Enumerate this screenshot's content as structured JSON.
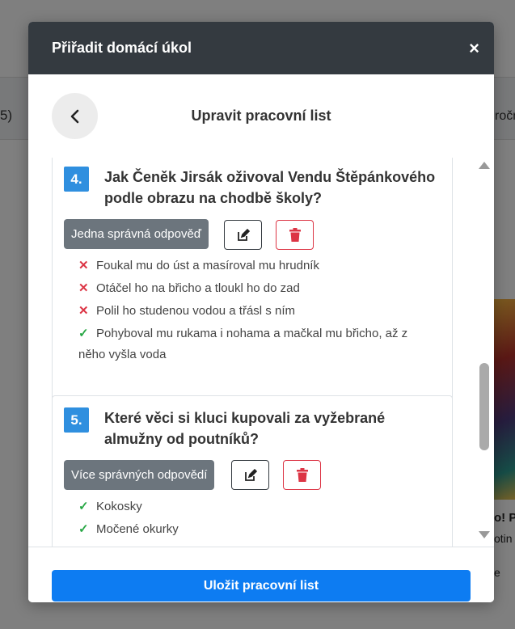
{
  "background": {
    "left_text": "5)",
    "right_text": "ročn",
    "caption1": "o! P",
    "caption2": "otin",
    "caption3": "e"
  },
  "modal": {
    "title": "Přiřadit domácí úkol",
    "close_symbol": "×",
    "sub_title": "Upravit pracovní list",
    "back_icon": "chevron-left",
    "save_label": "Uložit pracovní list"
  },
  "questions": [
    {
      "number": "4.",
      "text": "Jak Čeněk Jirsák oživoval Vendu Štěpánkového podle obrazu na chodbě školy?",
      "type_label": "Jedna správná odpověď",
      "answers": [
        {
          "mark": "✕",
          "correct": false,
          "text": "Foukal mu do úst a masíroval mu hrudník"
        },
        {
          "mark": "✕",
          "correct": false,
          "text": "Otáčel ho na břicho a tloukl ho do zad"
        },
        {
          "mark": "✕",
          "correct": false,
          "text": "Polil ho studenou vodou a třásl s ním"
        },
        {
          "mark": "✓",
          "correct": true,
          "text": "Pohyboval mu rukama i nohama a mačkal mu břicho, až z něho vyšla voda"
        }
      ]
    },
    {
      "number": "5.",
      "text": "Které věci si kluci kupovali za vyžebrané almužny od poutníků?",
      "type_label": "Více správných odpovědí",
      "answers": [
        {
          "mark": "✓",
          "correct": true,
          "text": "Kokosky"
        },
        {
          "mark": "✓",
          "correct": true,
          "text": "Močené okurky"
        }
      ]
    }
  ],
  "colors": {
    "header_bg": "#343a40",
    "number_badge": "#2f8fdf",
    "type_badge": "#6c757d",
    "wrong": "#dc3545",
    "right": "#28a745",
    "primary": "#0d7cf2"
  }
}
